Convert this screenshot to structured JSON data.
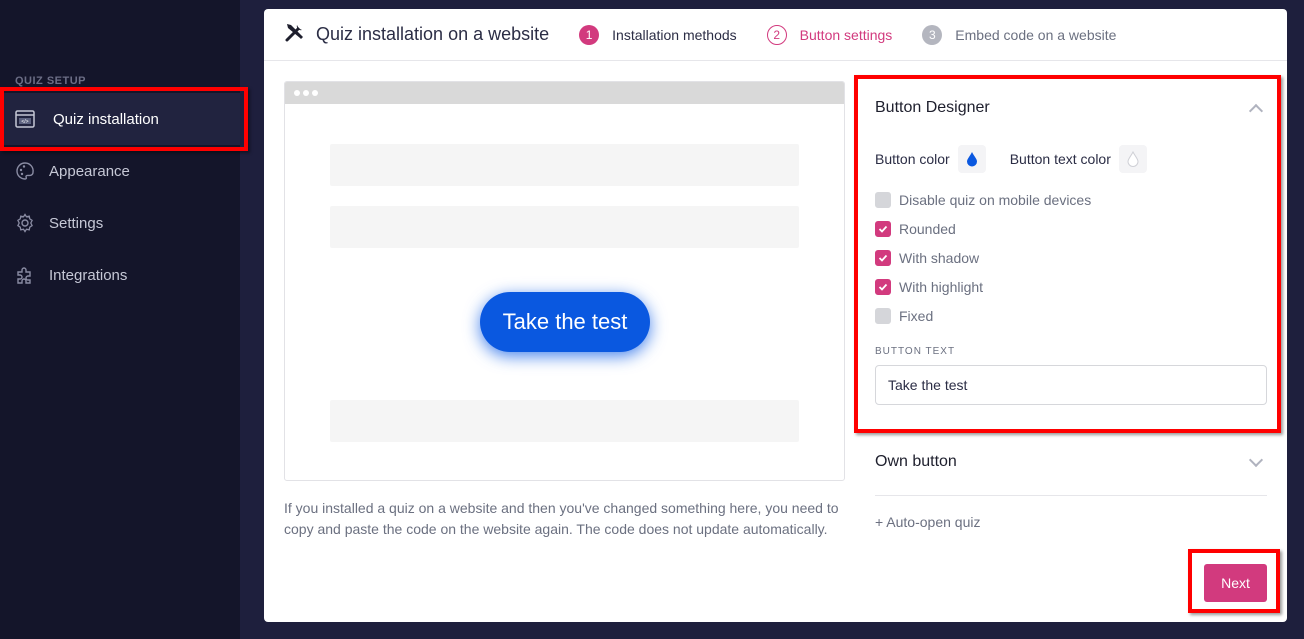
{
  "sidebar": {
    "section_title": "QUIZ SETUP",
    "items": [
      {
        "label": "Quiz installation",
        "icon": "code-window-icon",
        "active": true
      },
      {
        "label": "Appearance",
        "icon": "palette-icon",
        "active": false
      },
      {
        "label": "Settings",
        "icon": "gear-icon",
        "active": false
      },
      {
        "label": "Integrations",
        "icon": "puzzle-icon",
        "active": false
      }
    ]
  },
  "header": {
    "icon": "tools-icon",
    "title": "Quiz installation on a website",
    "steps": [
      {
        "number": "1",
        "label": "Installation methods",
        "state": "completed"
      },
      {
        "number": "2",
        "label": "Button settings",
        "state": "current"
      },
      {
        "number": "3",
        "label": "Embed code on a website",
        "state": "upcoming"
      }
    ]
  },
  "preview": {
    "button_text": "Take the test",
    "button_color": "#0a58e0",
    "note": "If you installed a quiz on a website and then you've changed something here, you need to copy and paste the code on the website again. The code does not update automatically."
  },
  "designer": {
    "title": "Button Designer",
    "button_color_label": "Button color",
    "button_color": "#0a58e0",
    "button_text_color_label": "Button text color",
    "button_text_color": "#ffffff",
    "options": [
      {
        "label": "Disable quiz on mobile devices",
        "checked": false
      },
      {
        "label": "Rounded",
        "checked": true
      },
      {
        "label": "With shadow",
        "checked": true
      },
      {
        "label": "With highlight",
        "checked": true
      },
      {
        "label": "Fixed",
        "checked": false
      }
    ],
    "button_text_label": "BUTTON TEXT",
    "button_text_value": "Take the test"
  },
  "own_button": {
    "title": "Own button"
  },
  "auto_open": {
    "label": "+ Auto-open quiz"
  },
  "footer": {
    "next_label": "Next"
  },
  "colors": {
    "accent": "#d23a7e",
    "sidebar_bg": "#14152a",
    "page_bg": "#1e1f3d"
  }
}
